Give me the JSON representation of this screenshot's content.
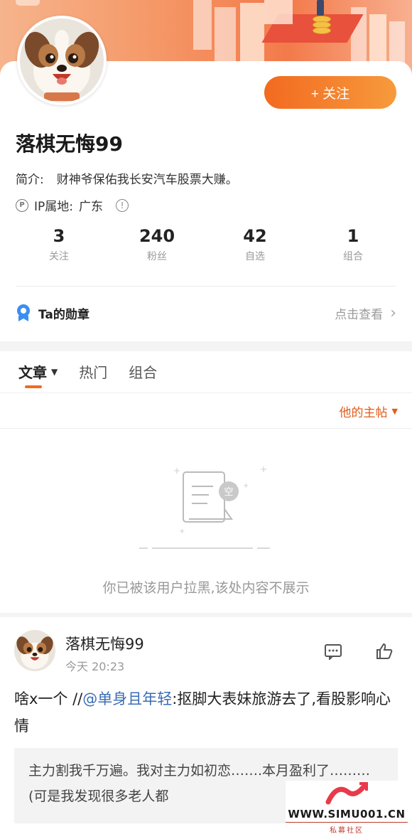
{
  "profile": {
    "follow_label": "+ 关注",
    "username": "落棋无悔99",
    "bio_label": "简介:",
    "bio_text": "财神爷保佑我长安汽车股票大赚。",
    "ip_label": "IP属地:",
    "ip_value": "广东",
    "ip_icon": "ip-icon",
    "info_icon": "info-icon"
  },
  "stats": [
    {
      "value": "3",
      "label": "关注"
    },
    {
      "value": "240",
      "label": "粉丝"
    },
    {
      "value": "42",
      "label": "自选"
    },
    {
      "value": "1",
      "label": "组合"
    }
  ],
  "badges": {
    "title": "Ta的勋章",
    "link": "点击查看"
  },
  "tabs": [
    {
      "label": "文章",
      "active": true
    },
    {
      "label": "热门",
      "active": false
    },
    {
      "label": "组合",
      "active": false
    }
  ],
  "filter": {
    "label": "他的主帖"
  },
  "empty": {
    "badge": "空",
    "text": "你已被该用户拉黑,该处内容不展示"
  },
  "post": {
    "author": "落棋无悔99",
    "time": "今天 20:23",
    "text_prefix": "啥x一个 //",
    "mention": "@单身且年轻",
    "text_suffix": ":抠脚大表妹旅游去了,看股影响心情",
    "quote": "主力割我千万遍。我对主力如初恋…….本月盈利了………(可是我发现很多老人都"
  },
  "watermark": {
    "site": "WWW.SIMU001.CN",
    "sub": "私募社区"
  },
  "colors": {
    "accent": "#f26a20",
    "mention": "#3a6db5",
    "filter": "#e25c1a"
  }
}
